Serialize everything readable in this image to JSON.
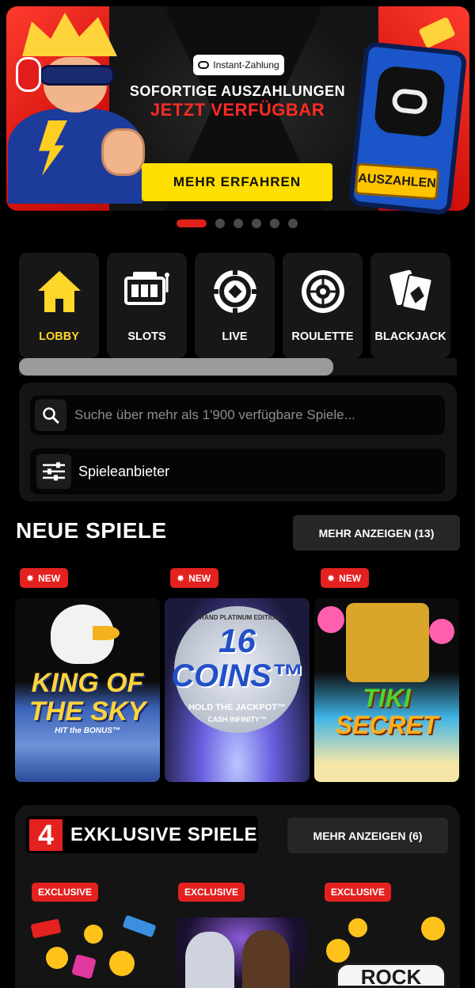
{
  "banner": {
    "pill_label": "Instant-Zahlung",
    "headline_line1": "SOFORTIGE AUSZAHLUNGEN",
    "headline_line2": "JETZT VERFÜGBAR",
    "cta_label": "MEHR ERFAHREN",
    "phone_button_label": "AUSZAHLEN",
    "slide_count": 6,
    "active_slide": 1
  },
  "categories": [
    {
      "label": "LOBBY",
      "icon": "home-icon",
      "active": true
    },
    {
      "label": "SLOTS",
      "icon": "slot-machine-icon",
      "active": false
    },
    {
      "label": "LIVE",
      "icon": "chip-icon",
      "active": false
    },
    {
      "label": "ROULETTE",
      "icon": "roulette-icon",
      "active": false
    },
    {
      "label": "BLACKJACK",
      "icon": "cards-icon",
      "active": false
    }
  ],
  "search": {
    "placeholder": "Suche über mehr als 1'900 verfügbare Spiele...",
    "value": ""
  },
  "provider_filter": {
    "label": "Spieleanbieter"
  },
  "new_games": {
    "title": "NEUE SPIELE",
    "more_label": "MEHR ANZEIGEN (13)",
    "badge_label": "NEW",
    "games": [
      {
        "line1": "KING OF",
        "line2": "THE SKY",
        "tagline": "HIT the BONUS™"
      },
      {
        "line1": "16",
        "line2": "COINS™",
        "tagline": "HOLD THE JACKPOT™",
        "tagline2": "CASH INFINITY™",
        "edition": "GRAND PLATINUM EDITION"
      },
      {
        "line1": "TIKI",
        "line2": "SECRET"
      }
    ]
  },
  "exclusive_games": {
    "title": "EXKLUSIVE SPIELE",
    "logo_text": "4",
    "more_label": "MEHR ANZEIGEN (6)",
    "badge_label": "EXCLUSIVE",
    "games": [
      {
        "partial_title": ""
      },
      {
        "partial_title": ""
      },
      {
        "partial_title": "ROCK"
      }
    ]
  },
  "colors": {
    "accent_red": "#e3211f",
    "cta_yellow": "#ffdf00",
    "active_category": "#ffd62a",
    "background": "#000000"
  }
}
